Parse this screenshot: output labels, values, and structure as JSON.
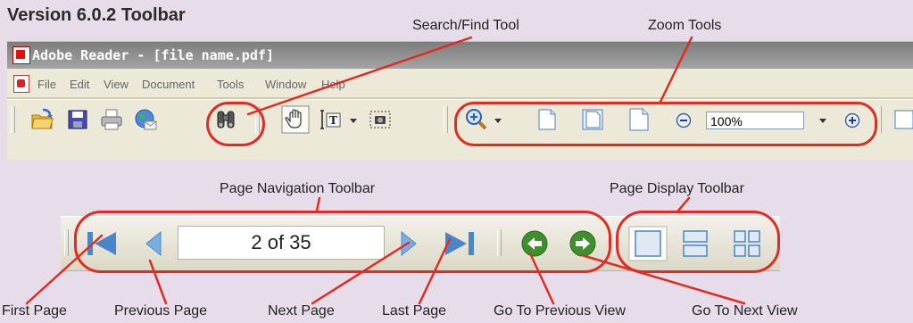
{
  "heading": "Version 6.0.2 Toolbar",
  "window": {
    "title": "Adobe Reader - [file name.pdf]",
    "menu": [
      "File",
      "Edit",
      "View",
      "Document",
      "Tools",
      "Window",
      "Help"
    ],
    "zoom_value": "100%"
  },
  "callouts": {
    "search": "Search/Find Tool",
    "zoom": "Zoom Tools",
    "page_navigation": "Page Navigation Toolbar",
    "page_display": "Page Display Toolbar"
  },
  "navigation": {
    "page_indicator": "2 of 35"
  },
  "bottom_labels": {
    "first_page": "First Page",
    "previous_page": "Previous Page",
    "next_page": "Next Page",
    "last_page": "Last Page",
    "go_previous_view": "Go To Previous View",
    "go_next_view": "Go To Next View"
  },
  "colors": {
    "background": "#e6dcea",
    "callout_ring": "#e02c22",
    "nav_arrow": "#4a86c8",
    "view_button": "#3f8f2e"
  },
  "icons": [
    "open-folder-icon",
    "save-disk-icon",
    "print-icon",
    "email-globe-icon",
    "binoculars-icon",
    "hand-icon",
    "text-select-icon",
    "snapshot-icon",
    "zoom-in-magnifier-icon",
    "page-icon",
    "zoom-out-icon",
    "zoom-in-icon"
  ]
}
